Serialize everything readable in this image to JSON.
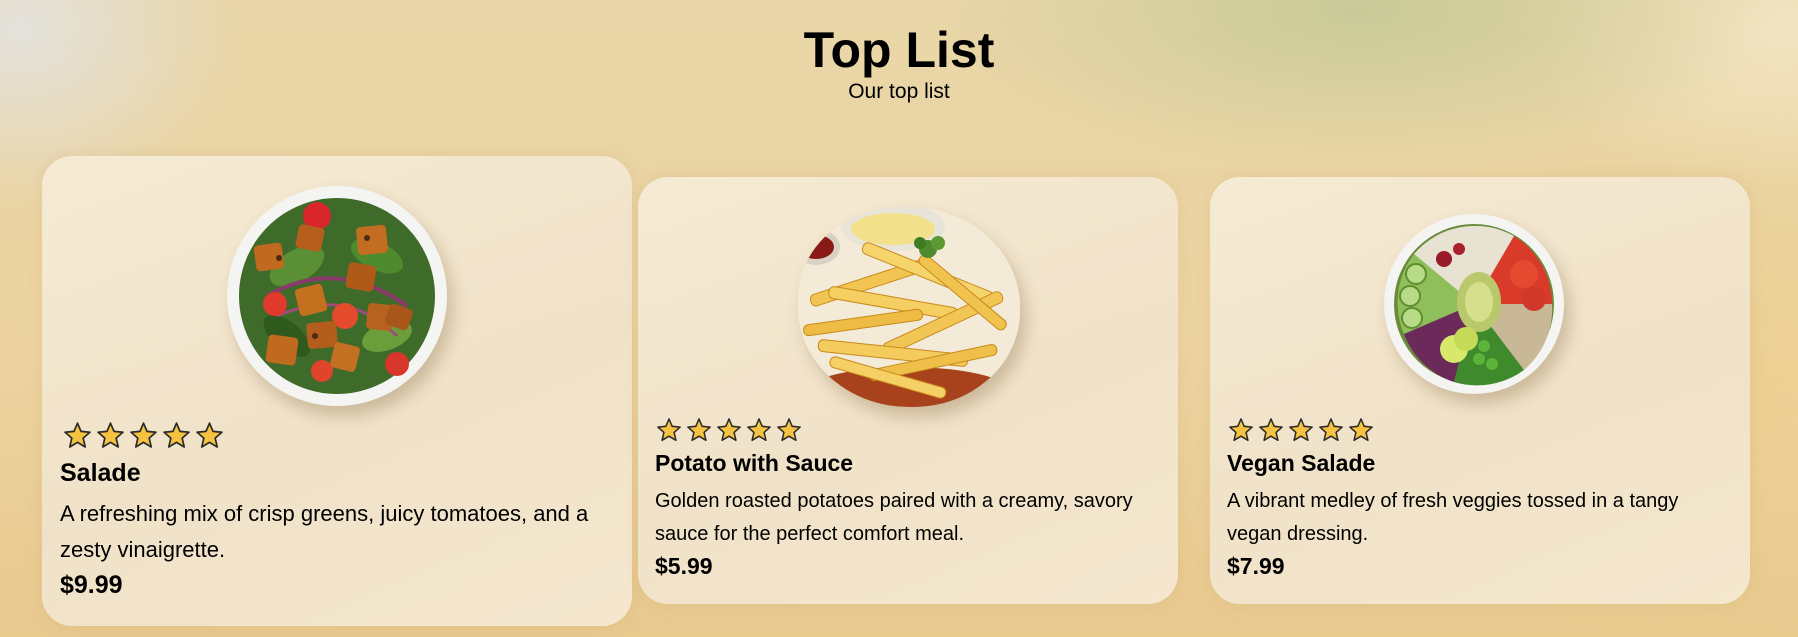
{
  "header": {
    "title": "Top List",
    "subtitle": "Our top list"
  },
  "colors": {
    "star_fill": "#f5c242",
    "star_stroke": "#2a2a2a",
    "card_background": "#f4e8d2"
  },
  "cards": [
    {
      "image_icon": "salad-plate-image",
      "rating": 5,
      "name": "Salade",
      "description": "A refreshing mix of crisp greens, juicy tomatoes, and a zesty vinaigrette.",
      "price": "$9.99"
    },
    {
      "image_icon": "fries-with-sauce-image",
      "rating": 5,
      "name": "Potato with Sauce",
      "description": "Golden roasted potatoes paired with a creamy, savory sauce for the perfect comfort meal.",
      "price": "$5.99"
    },
    {
      "image_icon": "vegan-bowl-image",
      "rating": 5,
      "name": "Vegan Salade",
      "description": "A vibrant medley of fresh veggies tossed in a tangy vegan dressing.",
      "price": "$7.99"
    }
  ]
}
